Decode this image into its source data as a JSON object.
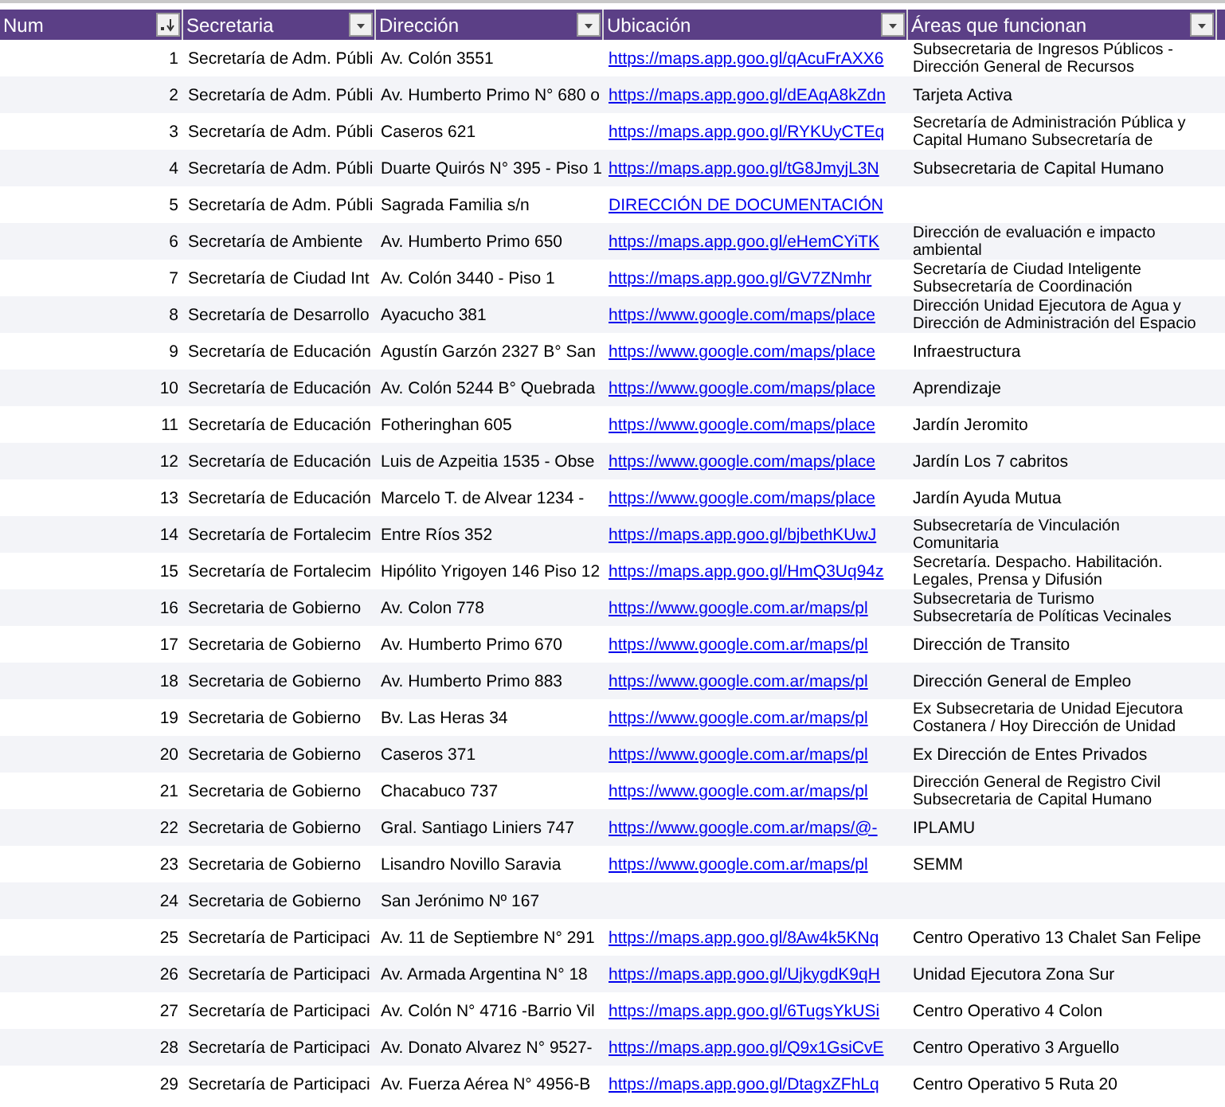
{
  "table": {
    "columns": [
      {
        "label": "Num",
        "sorted": true
      },
      {
        "label": "Secretaria",
        "sorted": false
      },
      {
        "label": "Dirección",
        "sorted": false
      },
      {
        "label": "Ubicación",
        "sorted": false
      },
      {
        "label": "Áreas que funcionan",
        "sorted": false
      }
    ],
    "rows": [
      {
        "num": "1",
        "secretaria": "Secretaría de Adm. Públi",
        "direccion": "Av. Colón 3551",
        "ubicacion": "https://maps.app.goo.gl/qAcuFrAXX6",
        "areas": "Subsecretaria de Ingresos Públicos -\nDirección General de Recursos"
      },
      {
        "num": "2",
        "secretaria": "Secretaría de Adm. Públi",
        "direccion": "Av. Humberto Primo N° 680 o",
        "ubicacion": "https://maps.app.goo.gl/dEAqA8kZdn",
        "areas": "Tarjeta Activa"
      },
      {
        "num": "3",
        "secretaria": "Secretaría de Adm. Públi",
        "direccion": "Caseros 621",
        "ubicacion": "https://maps.app.goo.gl/RYKUyCTEq",
        "areas": "Secretaría de Administración Pública y\nCapital Humano Subsecretaría de"
      },
      {
        "num": "4",
        "secretaria": "Secretaría de Adm. Públi",
        "direccion": "Duarte Quirós N° 395 - Piso 1",
        "ubicacion": "https://maps.app.goo.gl/tG8JmyjL3N",
        "areas": "Subsecretaria de Capital Humano"
      },
      {
        "num": "5",
        "secretaria": "Secretaría de Adm. Públi",
        "direccion": "Sagrada Familia s/n",
        "ubicacion": "DIRECCIÓN DE DOCUMENTACIÓN"
      },
      {
        "num": "6",
        "secretaria": "Secretaría de Ambiente",
        "direccion": "Av. Humberto Primo 650",
        "ubicacion": "https://maps.app.goo.gl/eHemCYiTK",
        "areas": "Dirección de evaluación e impacto\nambiental"
      },
      {
        "num": "7",
        "secretaria": "Secretaría de Ciudad Int",
        "direccion": "Av. Colón 3440 - Piso 1",
        "ubicacion": "https://maps.app.goo.gl/GV7ZNmhr",
        "areas": "Secretaría de Ciudad Inteligente\nSubsecretaría de Coordinación"
      },
      {
        "num": "8",
        "secretaria": "Secretaría de Desarrollo",
        "direccion": "Ayacucho 381",
        "ubicacion": "https://www.google.com/maps/place",
        "areas": "Dirección Unidad Ejecutora de Agua y\nDirección de Administración del Espacio"
      },
      {
        "num": "9",
        "secretaria": "Secretaría de Educación",
        "direccion": "Agustín Garzón 2327 B° San",
        "ubicacion": "https://www.google.com/maps/place",
        "areas": "Infraestructura"
      },
      {
        "num": "10",
        "secretaria": "Secretaría de Educación",
        "direccion": "Av. Colón 5244 B° Quebrada",
        "ubicacion": "https://www.google.com/maps/place",
        "areas": "Aprendizaje"
      },
      {
        "num": "11",
        "secretaria": "Secretaría de Educación",
        "direccion": "Fotheringhan 605",
        "ubicacion": "https://www.google.com/maps/place",
        "areas": "Jardín Jeromito"
      },
      {
        "num": "12",
        "secretaria": "Secretaría de Educación",
        "direccion": "Luis de Azpeitia 1535 - Obse",
        "ubicacion": "https://www.google.com/maps/place",
        "areas": "Jardín Los 7 cabritos"
      },
      {
        "num": "13",
        "secretaria": "Secretaría de Educación",
        "direccion": "Marcelo T. de Alvear 1234 -",
        "ubicacion": "https://www.google.com/maps/place",
        "areas": "Jardín Ayuda Mutua"
      },
      {
        "num": "14",
        "secretaria": "Secretaría de Fortalecim",
        "direccion": "Entre Ríos 352",
        "ubicacion": "https://maps.app.goo.gl/bjbethKUwJ",
        "areas": "Subsecretaría de Vinculación\nComunitaria"
      },
      {
        "num": "15",
        "secretaria": "Secretaría de Fortalecim",
        "direccion": "Hipólito Yrigoyen 146 Piso 12",
        "ubicacion": "https://maps.app.goo.gl/HmQ3Uq94z",
        "areas": "Secretaría. Despacho. Habilitación.\nLegales, Prensa y Difusión"
      },
      {
        "num": "16",
        "secretaria": "Secretaria de Gobierno",
        "direccion": "Av. Colon 778",
        "ubicacion": "https://www.google.com.ar/maps/pl",
        "areas": "Subsecretaria de Turismo\nSubsecretaría de Políticas Vecinales"
      },
      {
        "num": "17",
        "secretaria": "Secretaria de Gobierno",
        "direccion": "Av. Humberto Primo 670",
        "ubicacion": "https://www.google.com.ar/maps/pl",
        "areas": "Dirección de Transito"
      },
      {
        "num": "18",
        "secretaria": "Secretaria de Gobierno",
        "direccion": "Av. Humberto Primo 883",
        "ubicacion": "https://www.google.com.ar/maps/pl",
        "areas": "Dirección General de Empleo"
      },
      {
        "num": "19",
        "secretaria": "Secretaria de Gobierno",
        "direccion": "Bv. Las Heras 34",
        "ubicacion": "https://www.google.com.ar/maps/pl",
        "areas": "Ex Subsecretaria de Unidad Ejecutora\nCostanera / Hoy Dirección de Unidad"
      },
      {
        "num": "20",
        "secretaria": "Secretaria de Gobierno",
        "direccion": "Caseros 371",
        "ubicacion": "https://www.google.com.ar/maps/pl",
        "areas": "Ex Dirección de Entes Privados"
      },
      {
        "num": "21",
        "secretaria": "Secretaria de Gobierno",
        "direccion": "Chacabuco 737",
        "ubicacion": "https://www.google.com.ar/maps/pl",
        "areas": "Dirección General de Registro Civil\nSubsecretaria de Capital Humano"
      },
      {
        "num": "22",
        "secretaria": "Secretaria de Gobierno",
        "direccion": "Gral. Santiago Liniers 747",
        "ubicacion": "https://www.google.com.ar/maps/@-",
        "areas": "IPLAMU"
      },
      {
        "num": "23",
        "secretaria": "Secretaria de Gobierno",
        "direccion": "Lisandro Novillo Saravia",
        "ubicacion": "https://www.google.com.ar/maps/pl",
        "areas": "SEMM"
      },
      {
        "num": "24",
        "secretaria": "Secretaria de Gobierno",
        "direccion": "San Jerónimo Nº 167"
      },
      {
        "num": "25",
        "secretaria": "Secretaría de Participaci",
        "direccion": "Av. 11 de Septiembre N° 291",
        "ubicacion": "https://maps.app.goo.gl/8Aw4k5KNq",
        "areas": "Centro Operativo 13 Chalet San Felipe"
      },
      {
        "num": "26",
        "secretaria": "Secretaría de Participaci",
        "direccion": "Av. Armada Argentina N° 18",
        "ubicacion": "https://maps.app.goo.gl/UjkygdK9qH",
        "areas": "Unidad Ejecutora Zona Sur"
      },
      {
        "num": "27",
        "secretaria": "Secretaría de Participaci",
        "direccion": "Av. Colón N° 4716 -Barrio Vil",
        "ubicacion": "https://maps.app.goo.gl/6TugsYkUSi",
        "areas": "Centro Operativo 4 Colon"
      },
      {
        "num": "28",
        "secretaria": "Secretaría de Participaci",
        "direccion": "Av. Donato Alvarez N° 9527-",
        "ubicacion": "https://maps.app.goo.gl/Q9x1GsiCvE",
        "areas": "Centro Operativo 3 Arguello"
      },
      {
        "num": "29",
        "secretaria": "Secretaría de Participaci",
        "direccion": "Av. Fuerza Aérea N° 4956-B",
        "ubicacion": "https://maps.app.goo.gl/DtagxZFhLq",
        "areas": "Centro Operativo 5 Ruta 20"
      }
    ]
  }
}
